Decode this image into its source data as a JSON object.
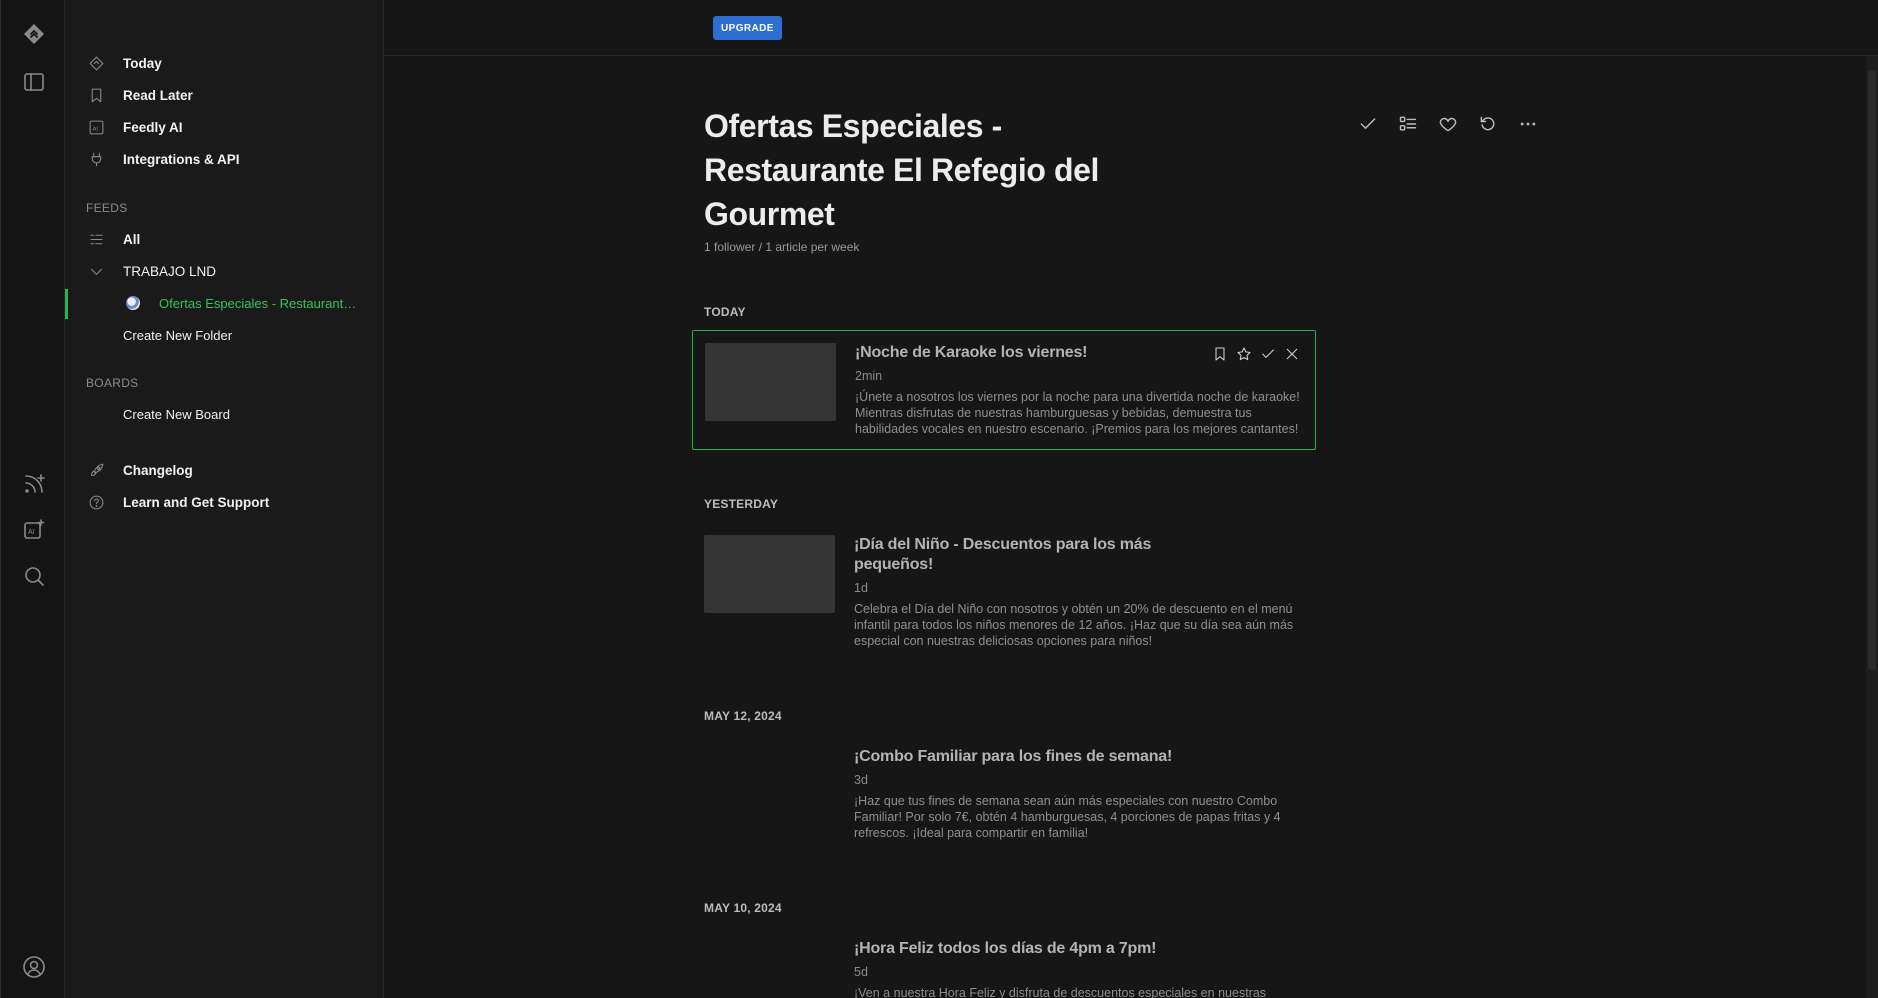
{
  "colors": {
    "accent_green": "#2bb24c",
    "upgrade_blue": "#2d6fd1",
    "background": "#161616",
    "sidebar_bg": "#1a1a1a"
  },
  "rail": {
    "icons": [
      "feedly-logo-icon",
      "sidebar-toggle-icon",
      "add-feed-icon",
      "add-ai-feed-icon",
      "search-icon",
      "user-account-icon"
    ]
  },
  "nav": {
    "top_items": [
      {
        "label": "Today",
        "icon": "today-diamond-icon"
      },
      {
        "label": "Read Later",
        "icon": "bookmark-icon"
      },
      {
        "label": "Feedly AI",
        "icon": "ai-icon"
      },
      {
        "label": "Integrations & API",
        "icon": "plug-icon"
      }
    ],
    "feeds_header": "FEEDS",
    "feeds_all": "All",
    "folder_name": "TRABAJO LND",
    "active_feed": "Ofertas Especiales - Restaurante El Refegio del Gourmet",
    "create_folder": "Create New Folder",
    "boards_header": "BOARDS",
    "create_board": "Create New Board",
    "bottom_items": [
      {
        "label": "Changelog",
        "icon": "rocket-icon"
      },
      {
        "label": "Learn and Get Support",
        "icon": "help-circle-icon"
      }
    ]
  },
  "topbar": {
    "upgrade_label": "UPGRADE"
  },
  "feed": {
    "title": "Ofertas Especiales - Restaurante El Refegio del Gourmet",
    "meta": "1 follower / 1 article per week",
    "actions": [
      "mark-read-icon",
      "layout-list-icon",
      "follow-heart-icon",
      "refresh-icon",
      "more-icon"
    ]
  },
  "sections": [
    {
      "header": "TODAY",
      "articles": [
        {
          "title": "¡Noche de Karaoke los viernes!",
          "age": "2min",
          "snippet": "¡Únete a nosotros los viernes por la noche para una divertida noche de karaoke! Mientras disfrutas de nuestras hamburguesas y bebidas, demuestra tus habilidades vocales en nuestro escenario. ¡Premios para los mejores cantantes!"
        }
      ]
    },
    {
      "header": "YESTERDAY",
      "articles": [
        {
          "title": "¡Día del Niño - Descuentos para los más pequeños!",
          "age": "1d",
          "snippet": "Celebra el Día del Niño con nosotros y obtén un 20% de descuento en el menú infantil para todos los niños menores de 12 años. ¡Haz que su día sea aún más especial con nuestras deliciosas opciones para niños!"
        }
      ]
    },
    {
      "header": "MAY 12, 2024",
      "articles": [
        {
          "title": "¡Combo Familiar para los fines de semana!",
          "age": "3d",
          "snippet": "¡Haz que tus fines de semana sean aún más especiales con nuestro Combo Familiar! Por solo 7€, obtén 4 hamburguesas, 4 porciones de papas fritas y 4 refrescos. ¡Ideal para compartir en familia!"
        }
      ]
    },
    {
      "header": "MAY 10, 2024",
      "articles": [
        {
          "title": "¡Hora Feliz todos los días de 4pm a 7pm!",
          "age": "5d",
          "snippet": "¡Ven a nuestra Hora Feliz y disfruta de descuentos especiales en nuestras"
        }
      ]
    }
  ]
}
